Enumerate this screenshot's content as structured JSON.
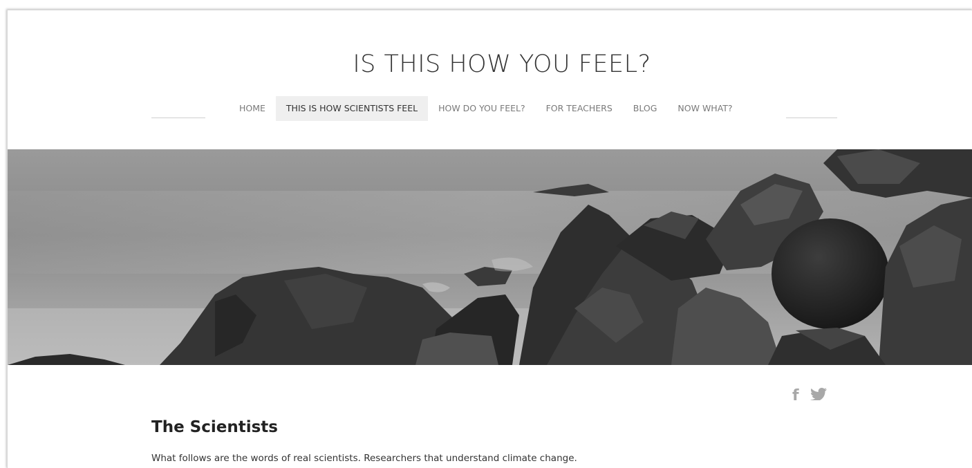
{
  "site": {
    "title": "IS THIS HOW YOU FEEL?"
  },
  "nav": {
    "items": [
      {
        "label": "HOME"
      },
      {
        "label": "THIS IS HOW SCIENTISTS FEEL"
      },
      {
        "label": "HOW DO YOU FEEL?"
      },
      {
        "label": "FOR TEACHERS"
      },
      {
        "label": "BLOG"
      },
      {
        "label": "NOW WHAT?"
      }
    ],
    "active_label": "THIS IS HOW SCIENTISTS FEEL"
  },
  "hero": {
    "icon": "rocky-seashore-photo"
  },
  "social": {
    "facebook_icon": "f",
    "twitter_icon": "🐦"
  },
  "content": {
    "heading": "The Scientists",
    "intro": "What follows are the words of real scientists. Researchers that understand climate change."
  },
  "colors": {
    "title": "#333333",
    "nav_text": "#7a7a7a",
    "nav_active_bg": "#efefef",
    "social": "#a8a8a8"
  }
}
